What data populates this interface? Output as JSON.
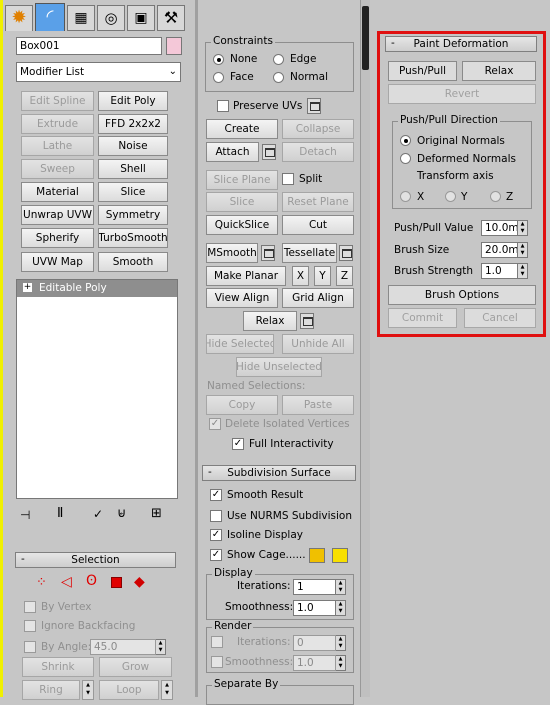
{
  "tabs": {
    "create": "create-tab",
    "modify": "modify-tab",
    "hierarchy": "hierarchy-tab",
    "motion": "motion-tab",
    "display": "display-tab",
    "utilities": "utilities-tab"
  },
  "object_name": "Box001",
  "modifier_list": "Modifier List",
  "modifier_buttons": [
    [
      "Edit Spline",
      "Edit Poly"
    ],
    [
      "Extrude",
      "FFD 2x2x2"
    ],
    [
      "Lathe",
      "Noise"
    ],
    [
      "Sweep",
      "Shell"
    ],
    [
      "Material",
      "Slice"
    ],
    [
      "Unwrap UVW",
      "Symmetry"
    ],
    [
      "Spherify",
      "TurboSmooth"
    ],
    [
      "UVW Map",
      "Smooth"
    ]
  ],
  "stack_item": "Editable Poly",
  "selection": {
    "title": "Selection",
    "by_vertex": "By Vertex",
    "ignore_backfacing": "Ignore Backfacing",
    "by_angle": "By Angle:",
    "angle_value": "45.0",
    "shrink": "Shrink",
    "grow": "Grow",
    "ring": "Ring",
    "loop": "Loop"
  },
  "mid": {
    "constraints": "Constraints",
    "none": "None",
    "edge": "Edge",
    "face": "Face",
    "normal": "Normal",
    "preserve_uvs": "Preserve UVs",
    "create": "Create",
    "collapse": "Collapse",
    "attach": "Attach",
    "detach": "Detach",
    "slice_plane": "Slice Plane",
    "split": "Split",
    "slice": "Slice",
    "reset_plane": "Reset Plane",
    "quickslice": "QuickSlice",
    "cut": "Cut",
    "msmooth": "MSmooth",
    "tessellate": "Tessellate",
    "make_planar": "Make Planar",
    "x": "X",
    "y": "Y",
    "z": "Z",
    "view_align": "View Align",
    "grid_align": "Grid Align",
    "relax": "Relax",
    "hide_selected": "Hide Selected",
    "unhide_all": "Unhide All",
    "hide_unselected": "Hide Unselected",
    "named_selections": "Named Selections:",
    "copy": "Copy",
    "paste": "Paste",
    "delete_isolated": "Delete Isolated Vertices",
    "full_interactivity": "Full Interactivity",
    "subdiv_title": "Subdivision Surface",
    "smooth_result": "Smooth Result",
    "use_nurms": "Use NURMS Subdivision",
    "isoline": "Isoline Display",
    "show_cage": "Show Cage......",
    "display": "Display",
    "iterations": "Iterations:",
    "iter_val": "1",
    "smoothness": "Smoothness:",
    "smooth_val": "1.0",
    "render": "Render",
    "r_iter_val": "0",
    "r_smooth_val": "1.0",
    "separate_by": "Separate By",
    "cage_color_1": "#f0c000",
    "cage_color_2": "#f8e000"
  },
  "paint": {
    "title": "Paint Deformation",
    "push_pull": "Push/Pull",
    "relax": "Relax",
    "revert": "Revert",
    "direction": "Push/Pull Direction",
    "original_normals": "Original Normals",
    "deformed_normals": "Deformed Normals",
    "transform_axis": "Transform axis",
    "x": "X",
    "y": "Y",
    "z": "Z",
    "push_pull_value_label": "Push/Pull Value",
    "push_pull_value": "10.0mm",
    "brush_size_label": "Brush Size",
    "brush_size": "20.0mm",
    "brush_strength_label": "Brush Strength",
    "brush_strength": "1.0",
    "brush_options": "Brush Options",
    "commit": "Commit",
    "cancel": "Cancel"
  },
  "colors": {
    "highlight": "#e01010",
    "swatch": "#f4c8d8"
  }
}
